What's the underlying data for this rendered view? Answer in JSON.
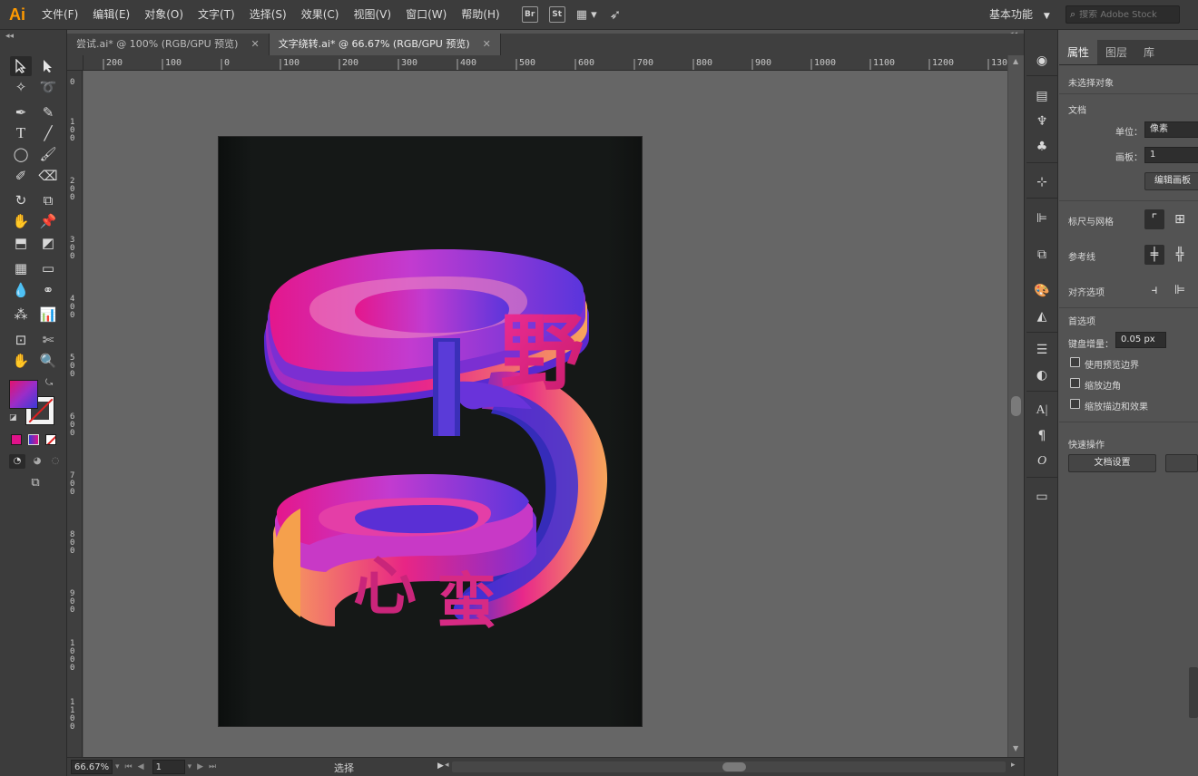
{
  "app": {
    "logo": "Ai"
  },
  "menu": [
    "文件(F)",
    "编辑(E)",
    "对象(O)",
    "文字(T)",
    "选择(S)",
    "效果(C)",
    "视图(V)",
    "窗口(W)",
    "帮助(H)"
  ],
  "menu_icons": {
    "bridge": "Br",
    "stock": "St"
  },
  "workspace": {
    "label": "基本功能"
  },
  "stock_search": {
    "placeholder": "搜索 Adobe Stock"
  },
  "tabs": [
    {
      "label": "尝试.ai* @ 100% (RGB/GPU 预览)",
      "active": false
    },
    {
      "label": "文字绕转.ai* @ 66.67% (RGB/GPU 预览)",
      "active": true
    }
  ],
  "ruler_top": [
    "200",
    "100",
    "0",
    "100",
    "200",
    "300",
    "400",
    "500",
    "600",
    "700",
    "800",
    "900",
    "1000",
    "1100",
    "1200",
    "1300"
  ],
  "ruler_left": [
    "0",
    "100",
    "200",
    "300",
    "400",
    "500",
    "600",
    "700",
    "800",
    "900",
    "1000",
    "1100"
  ],
  "artwork": {
    "glyph_top": "野",
    "glyph_mid": "心",
    "glyph_bottom": "蛮",
    "colors": {
      "pink": "#e81c8d",
      "magenta": "#c23bd0",
      "purple": "#6a2fd8",
      "orange": "#f8a65a",
      "background": "#151817"
    }
  },
  "status": {
    "zoom": "66.67%",
    "artboard": "1",
    "mode": "选择"
  },
  "panel": {
    "tabs": [
      "属性",
      "图层",
      "库"
    ],
    "no_selection": "未选择对象",
    "document_section": "文档",
    "unit_label": "单位：",
    "unit_value": "像素",
    "artboard_label": "画板：",
    "artboard_value": "1",
    "edit_artboards": "编辑画板",
    "rulers_grids": "标尺与网格",
    "guides": "参考线",
    "snap_options": "对齐选项",
    "preferences": "首选项",
    "keyboard_increment_label": "键盘增量：",
    "keyboard_increment_value": "0.05 px",
    "check_preview_bounds": "使用预览边界",
    "check_scale_corners": "缩放边角",
    "check_scale_strokes": "缩放描边和效果",
    "quick_actions": "快速操作",
    "doc_setup": "文档设置"
  },
  "toolbar_colors": {
    "fill_gradient_start": "#e2136f",
    "fill_gradient_end": "#3a3ad6",
    "swatch_color": "#e0128a"
  }
}
